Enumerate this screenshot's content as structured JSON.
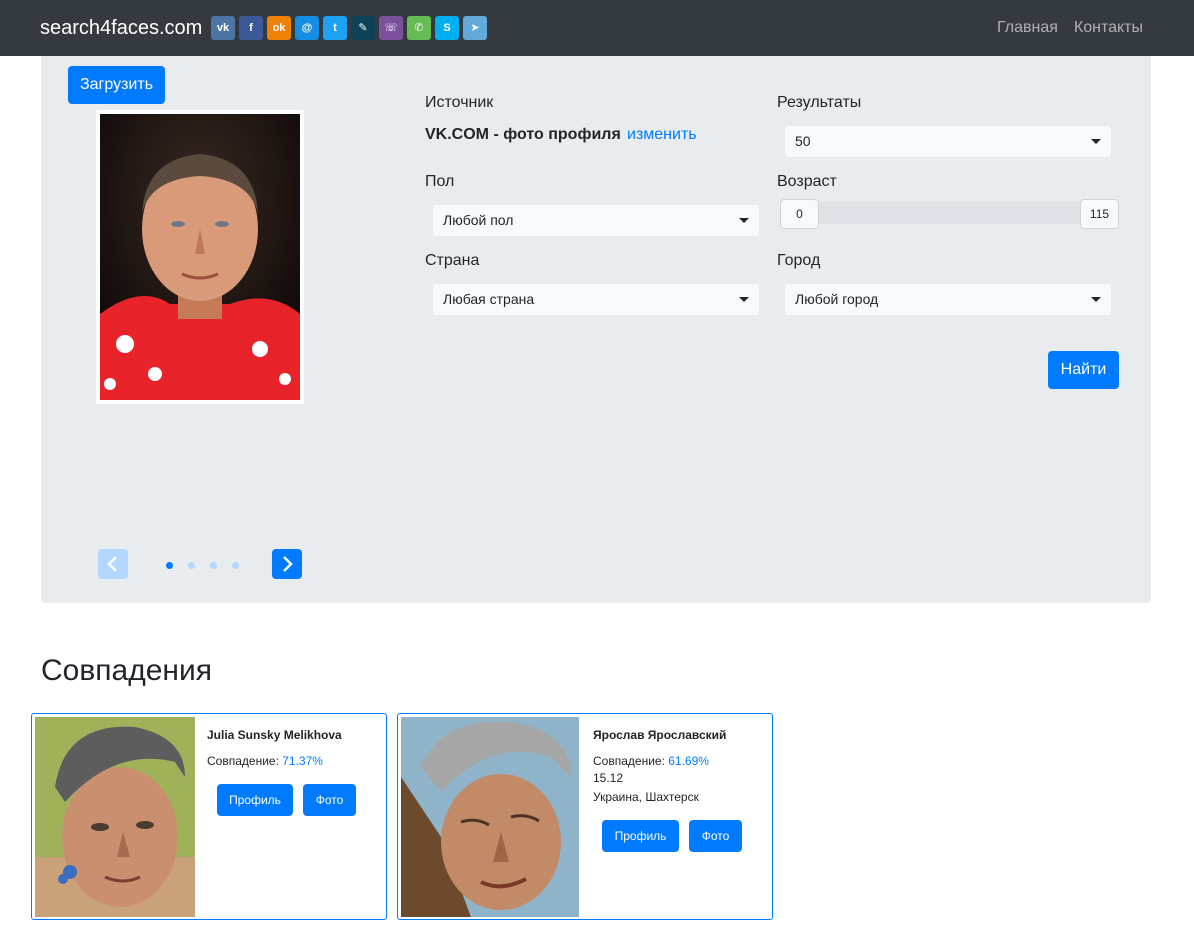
{
  "nav": {
    "brand": "search4faces.com",
    "social": [
      {
        "icon": "vk-icon",
        "glyph": "vk",
        "color": "#4c75a3"
      },
      {
        "icon": "facebook-icon",
        "glyph": "f",
        "color": "#3b5998"
      },
      {
        "icon": "odnoklassniki-icon",
        "glyph": "ok",
        "color": "#ee8208"
      },
      {
        "icon": "moimir-icon",
        "glyph": "@",
        "color": "#168de2"
      },
      {
        "icon": "twitter-icon",
        "glyph": "t",
        "color": "#1da1f2"
      },
      {
        "icon": "livejournal-icon",
        "glyph": "✎",
        "color": "#0d425a"
      },
      {
        "icon": "viber-icon",
        "glyph": "☏",
        "color": "#7b519d"
      },
      {
        "icon": "whatsapp-icon",
        "glyph": "✆",
        "color": "#65bc54"
      },
      {
        "icon": "skype-icon",
        "glyph": "S",
        "color": "#00aff0"
      },
      {
        "icon": "telegram-icon",
        "glyph": "➤",
        "color": "#64a9dc"
      }
    ],
    "links": [
      "Главная",
      "Контакты"
    ]
  },
  "panel": {
    "upload_label": "Загрузить",
    "source_label": "Источник",
    "source_value": "VK.COM - фото профиля",
    "source_change": "изменить",
    "results_label": "Результаты",
    "results_value": "50",
    "gender_label": "Пол",
    "gender_value": "Любой пол",
    "age_label": "Возраст",
    "age_min": "0",
    "age_max": "115",
    "country_label": "Страна",
    "country_value": "Любая страна",
    "city_label": "Город",
    "city_value": "Любой город",
    "find_label": "Найти"
  },
  "matches": {
    "title": "Совпадения",
    "cards": [
      {
        "name": "Julia Sunsky Melikhova",
        "match_label": "Совпадение: ",
        "match_value": "71.37%",
        "profile_label": "Профиль",
        "photo_label": "Фото"
      },
      {
        "name": "Ярослав Ярославский",
        "match_label": "Совпадение: ",
        "match_value": "61.69%",
        "date": "15.12",
        "location": "Украина, Шахтерск",
        "profile_label": "Профиль",
        "photo_label": "Фото"
      }
    ]
  }
}
